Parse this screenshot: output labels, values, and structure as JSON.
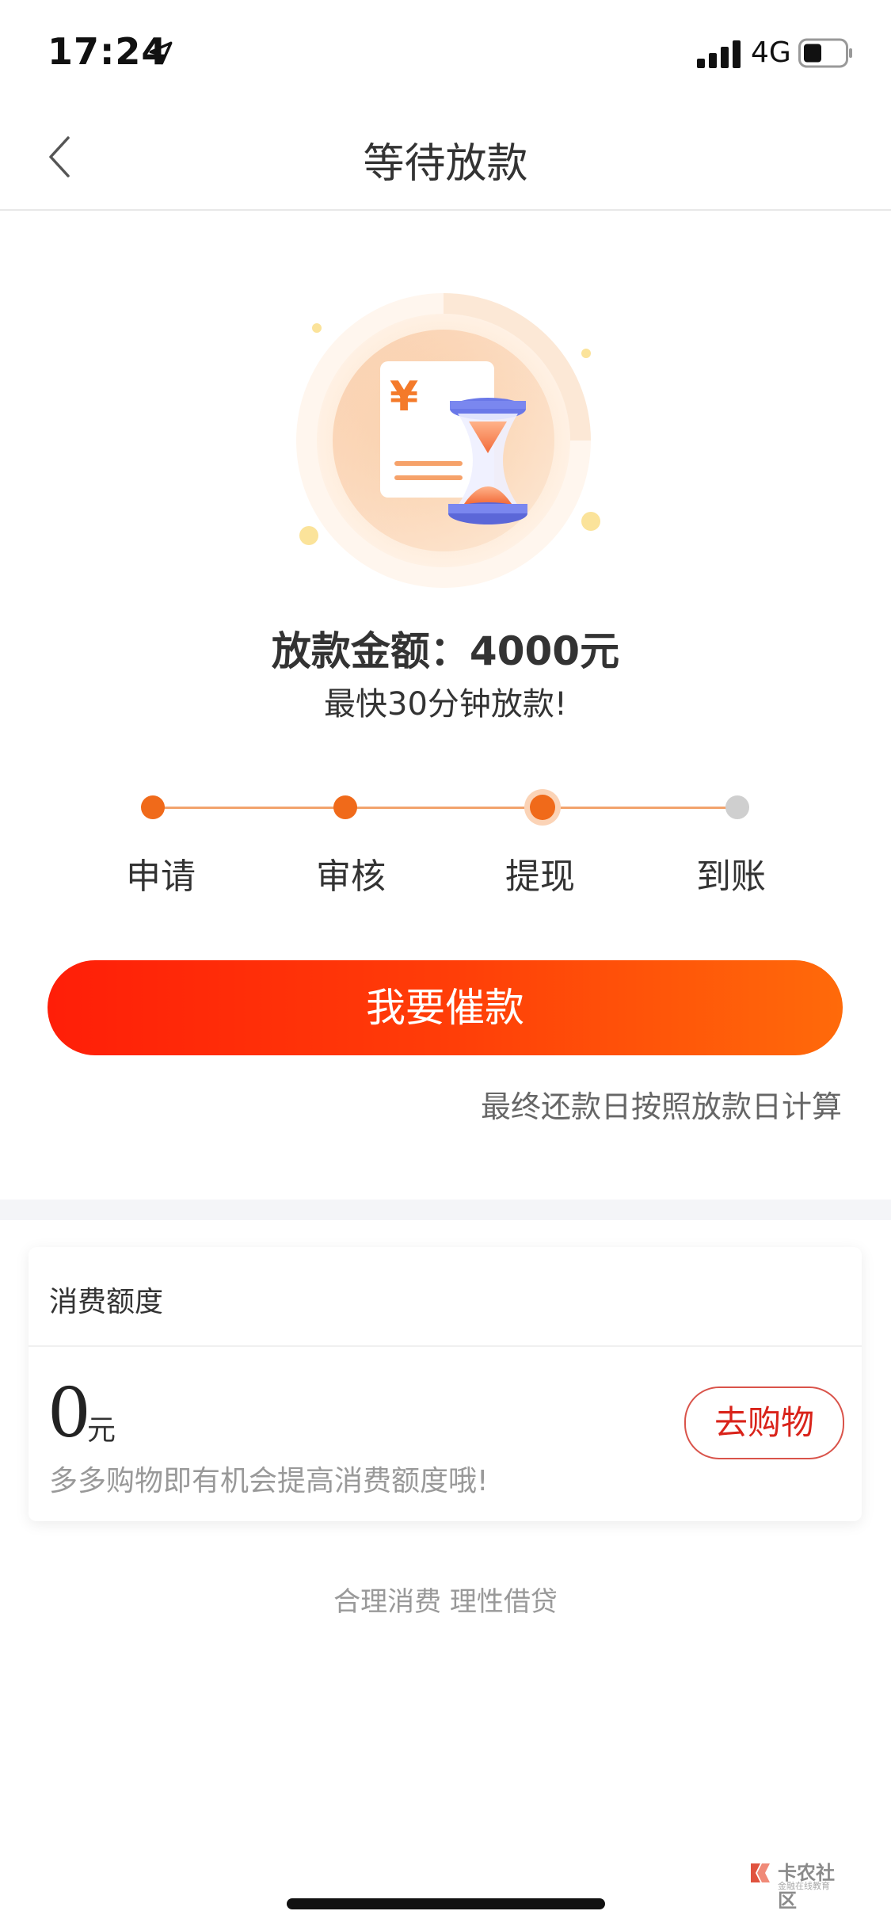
{
  "status": {
    "time": "17:24",
    "network": "4G"
  },
  "nav": {
    "title": "等待放款"
  },
  "loan": {
    "amount_label": "放款金额：",
    "amount_value": "4000元",
    "speed_note": "最快30分钟放款!"
  },
  "steps": {
    "items": [
      {
        "label": "申请",
        "state": "done"
      },
      {
        "label": "审核",
        "state": "done"
      },
      {
        "label": "提现",
        "state": "current"
      },
      {
        "label": "到账",
        "state": "pending"
      }
    ]
  },
  "actions": {
    "urge_label": "我要催款",
    "repay_note": "最终还款日按照放款日计算"
  },
  "credit": {
    "title": "消费额度",
    "amount": "0",
    "unit": "元",
    "hint": "多多购物即有机会提高消费额度哦!",
    "shop_label": "去购物"
  },
  "footer": {
    "slogan": "合理消费 理性借贷"
  },
  "watermark": {
    "text": "卡农社区",
    "sub": "金融在线教育"
  },
  "colors": {
    "accent": "#f06a1a",
    "button_start": "#ff1e08",
    "button_end": "#ff6a0a",
    "pending": "#cfcfcf"
  },
  "icons": {
    "back": "chevron-left-icon",
    "location": "location-arrow-icon",
    "signal": "signal-bars-icon",
    "battery": "battery-icon",
    "hero": "hourglass-document-icon"
  }
}
